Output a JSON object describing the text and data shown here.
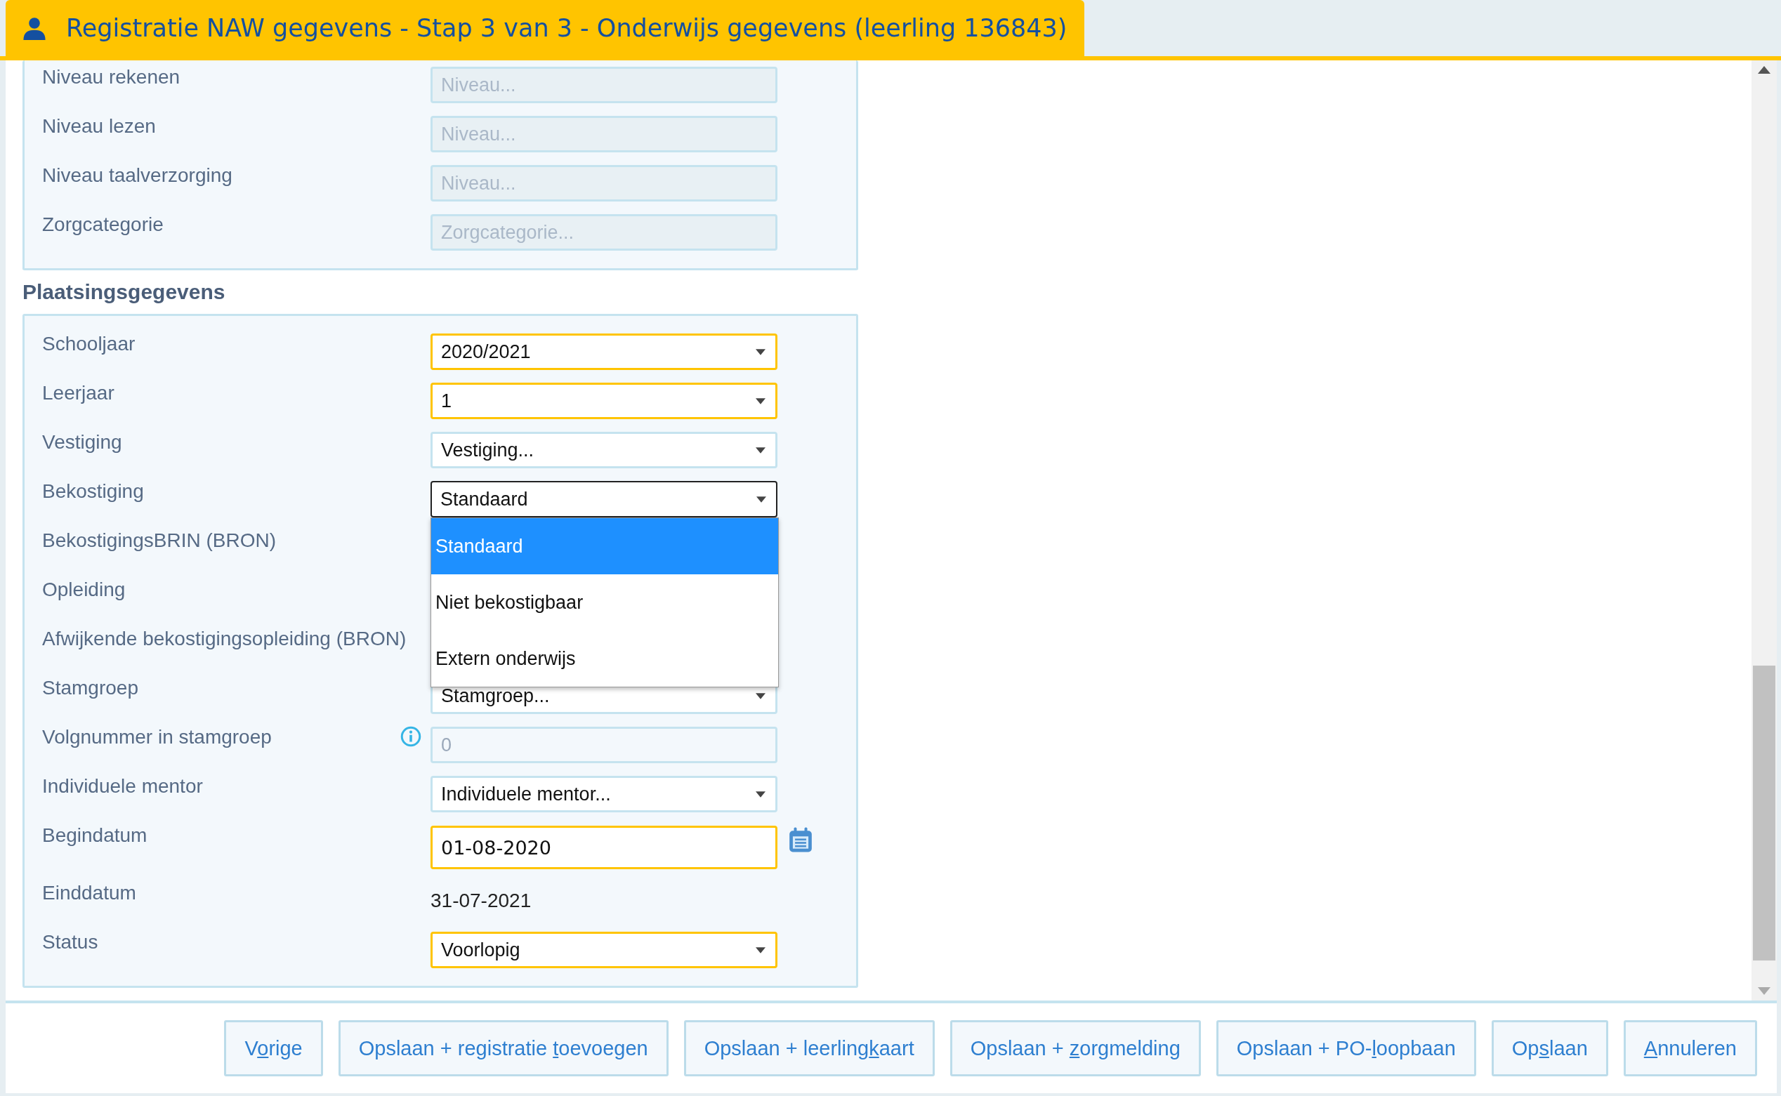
{
  "window": {
    "title": "Registratie NAW gegevens - Stap 3 van 3 - Onderwijs gegevens (leerling 136843)"
  },
  "niveau_rows": [
    {
      "label": "Niveau rekenen",
      "kind": "readonly",
      "placeholder": "Niveau..."
    },
    {
      "label": "Niveau lezen",
      "kind": "readonly",
      "placeholder": "Niveau..."
    },
    {
      "label": "Niveau taalverzorging",
      "kind": "readonly",
      "placeholder": "Niveau..."
    },
    {
      "label": "Zorgcategorie",
      "kind": "readonly",
      "placeholder": "Zorgcategorie..."
    }
  ],
  "section_title": "Plaatsingsgegevens",
  "plaatsing_rows": [
    {
      "label": "Schooljaar",
      "kind": "select",
      "value": "2020/2021",
      "required": true,
      "focused": false
    },
    {
      "label": "Leerjaar",
      "kind": "select",
      "value": "1",
      "required": true,
      "focused": false
    },
    {
      "label": "Vestiging",
      "kind": "select",
      "value": "Vestiging...",
      "required": false,
      "focused": false
    },
    {
      "label": "Bekostiging",
      "kind": "select",
      "value": "Standaard",
      "required": false,
      "focused": true,
      "expanded": true
    },
    {
      "label": "BekostigingsBRIN (BRON)",
      "kind": "covered"
    },
    {
      "label": "Opleiding",
      "kind": "covered"
    },
    {
      "label": "Afwijkende bekostigingsopleiding (BRON)",
      "kind": "covered"
    },
    {
      "label": "Stamgroep",
      "kind": "select",
      "value": "Stamgroep...",
      "required": false,
      "focused": false
    },
    {
      "label": "Volgnummer in stamgroep",
      "kind": "number",
      "value": "0",
      "disabled": true,
      "info": true
    },
    {
      "label": "Individuele mentor",
      "kind": "select",
      "value": "Individuele mentor...",
      "required": false,
      "focused": false
    },
    {
      "label": "Begindatum",
      "kind": "date",
      "value": "01-08-2020",
      "required": true
    },
    {
      "label": "Einddatum",
      "kind": "text",
      "value": "31-07-2021"
    },
    {
      "label": "Status",
      "kind": "select",
      "value": "Voorlopig",
      "required": true,
      "focused": false
    }
  ],
  "dropdown_options": [
    {
      "label": "Standaard",
      "selected": true
    },
    {
      "label": "Niet bekostigbaar",
      "selected": false
    },
    {
      "label": "Extern onderwijs",
      "selected": false
    }
  ],
  "buttons": [
    {
      "before": "V",
      "key": "o",
      "after": "rige"
    },
    {
      "before": "Opslaan + registratie ",
      "key": "t",
      "after": "oevoegen"
    },
    {
      "before": "Opslaan + leerling",
      "key": "k",
      "after": "aart"
    },
    {
      "before": "Opslaan + ",
      "key": "z",
      "after": "orgmelding"
    },
    {
      "before": "Opslaan + PO-",
      "key": "l",
      "after": "oopbaan"
    },
    {
      "before": "Op",
      "key": "s",
      "after": "laan"
    },
    {
      "key": "A",
      "after": "nnuleren"
    }
  ]
}
